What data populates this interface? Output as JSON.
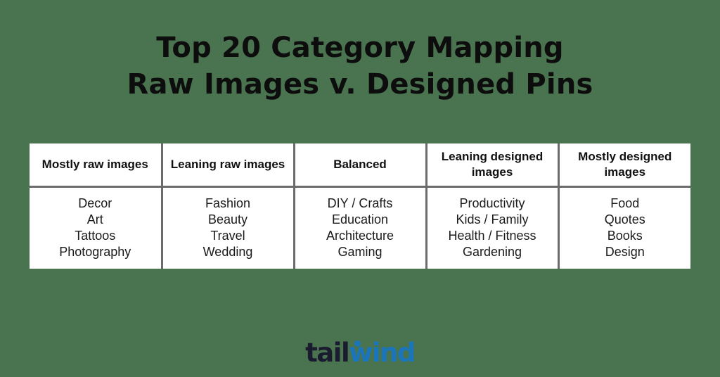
{
  "page": {
    "background_color": "#4a734f",
    "canvas_color": "#ffffff"
  },
  "title": {
    "line1": "Top 20 Category Mapping",
    "line2": "Raw Images v. Designed Pins",
    "color": "#0d0d0d"
  },
  "table": {
    "divider_color": "#6b6b6b",
    "headers": [
      "Mostly raw images",
      "Leaning raw images",
      "Balanced",
      "Leaning designed images",
      "Mostly designed images"
    ],
    "columns": [
      {
        "header": "Mostly raw images",
        "items": [
          "Decor",
          "Art",
          "Tattoos",
          "Photography"
        ]
      },
      {
        "header": "Leaning raw images",
        "items": [
          "Fashion",
          "Beauty",
          "Travel",
          "Wedding"
        ]
      },
      {
        "header": "Balanced",
        "items": [
          "DIY / Crafts",
          "Education",
          "Architecture",
          "Gaming"
        ]
      },
      {
        "header": "Leaning designed images",
        "items": [
          "Productivity",
          "Kids / Family",
          "Health / Fitness",
          "Gardening"
        ]
      },
      {
        "header": "Mostly designed images",
        "items": [
          "Food",
          "Quotes",
          "Books",
          "Design"
        ]
      }
    ]
  },
  "logo": {
    "part1": "tail",
    "part2": "wind",
    "part1_color": "#1b1b2f",
    "part2_color": "#1b75bb"
  }
}
